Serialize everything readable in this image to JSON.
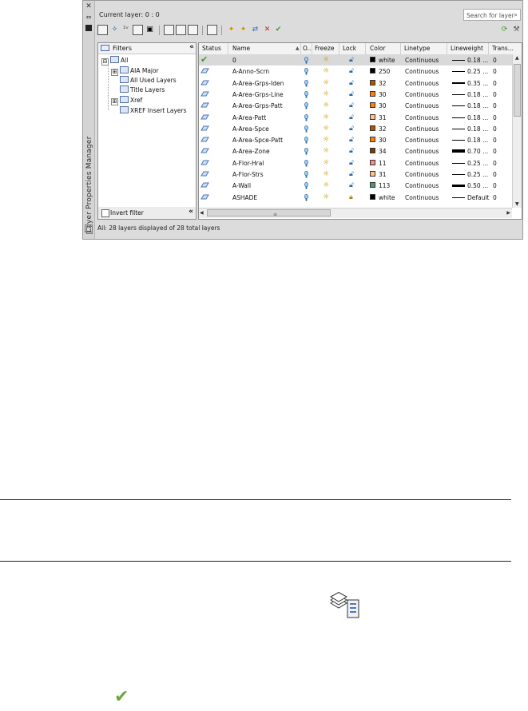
{
  "sidebar": {
    "title": "Layer Properties Manager"
  },
  "current_layer": "Current layer: 0 : 0",
  "search": {
    "placeholder": "Search for layer"
  },
  "filters": {
    "header": "Filters",
    "tree": [
      {
        "label": "All",
        "level": 0,
        "expander": "⊟"
      },
      {
        "label": "AIA Major",
        "level": 1,
        "expander": "⊞"
      },
      {
        "label": "All Used Layers",
        "level": 1,
        "expander": ""
      },
      {
        "label": "Title Layers",
        "level": 1,
        "expander": ""
      },
      {
        "label": "Xref",
        "level": 1,
        "expander": "⊞"
      },
      {
        "label": "XREF Insert Layers",
        "level": 1,
        "expander": ""
      }
    ],
    "invert_label": "Invert filter"
  },
  "columns": [
    "Status",
    "Name",
    "O..",
    "Freeze",
    "Lock",
    "Color",
    "Linetype",
    "Lineweight",
    "Trans..."
  ],
  "layers": [
    {
      "name": "0",
      "color": "white",
      "swatch": "#000000",
      "linetype": "Continuous",
      "lineweight": "0.18 ...",
      "lw_thick": 1,
      "trans": "0",
      "current": true,
      "lock": "unlocked"
    },
    {
      "name": "A-Anno-Scrn",
      "color": "250",
      "swatch": "#000000",
      "linetype": "Continuous",
      "lineweight": "0.25 ...",
      "lw_thick": 1,
      "trans": "0",
      "lock": "unlocked"
    },
    {
      "name": "A-Area-Grps-Iden",
      "color": "32",
      "swatch": "#b35400",
      "linetype": "Continuous",
      "lineweight": "0.35 ...",
      "lw_thick": 2,
      "trans": "0",
      "lock": "unlocked"
    },
    {
      "name": "A-Area-Grps-Line",
      "color": "30",
      "swatch": "#ff8000",
      "linetype": "Continuous",
      "lineweight": "0.18 ...",
      "lw_thick": 1,
      "trans": "0",
      "lock": "unlocked"
    },
    {
      "name": "A-Area-Grps-Patt",
      "color": "30",
      "swatch": "#ff8000",
      "linetype": "Continuous",
      "lineweight": "0.18 ...",
      "lw_thick": 1,
      "trans": "0",
      "lock": "unlocked"
    },
    {
      "name": "A-Area-Patt",
      "color": "31",
      "swatch": "#ffc08a",
      "linetype": "Continuous",
      "lineweight": "0.18 ...",
      "lw_thick": 1,
      "trans": "0",
      "lock": "unlocked"
    },
    {
      "name": "A-Area-Spce",
      "color": "32",
      "swatch": "#b35400",
      "linetype": "Continuous",
      "lineweight": "0.18 ...",
      "lw_thick": 1,
      "trans": "0",
      "lock": "unlocked"
    },
    {
      "name": "A-Area-Spce-Patt",
      "color": "30",
      "swatch": "#ff8000",
      "linetype": "Continuous",
      "lineweight": "0.18 ...",
      "lw_thick": 1,
      "trans": "0",
      "lock": "unlocked"
    },
    {
      "name": "A-Area-Zone",
      "color": "34",
      "swatch": "#7a3b00",
      "linetype": "Continuous",
      "lineweight": "0.70 ...",
      "lw_thick": 4,
      "trans": "0",
      "lock": "unlocked"
    },
    {
      "name": "A-Flor-Hral",
      "color": "11",
      "swatch": "#ff8a8a",
      "linetype": "Continuous",
      "lineweight": "0.25 ...",
      "lw_thick": 1,
      "trans": "0",
      "lock": "unlocked"
    },
    {
      "name": "A-Flor-Strs",
      "color": "31",
      "swatch": "#ffc08a",
      "linetype": "Continuous",
      "lineweight": "0.25 ...",
      "lw_thick": 1,
      "trans": "0",
      "lock": "unlocked"
    },
    {
      "name": "A-Wall",
      "color": "113",
      "swatch": "#4f9a6c",
      "linetype": "Continuous",
      "lineweight": "0.50 ...",
      "lw_thick": 3,
      "trans": "0",
      "lock": "unlocked"
    },
    {
      "name": "ASHADE",
      "color": "white",
      "swatch": "#000000",
      "linetype": "Continuous",
      "lineweight": "Default",
      "lw_thick": 1,
      "trans": "0",
      "lock": "locked"
    }
  ],
  "status": "All: 28 layers displayed of 28 total layers"
}
